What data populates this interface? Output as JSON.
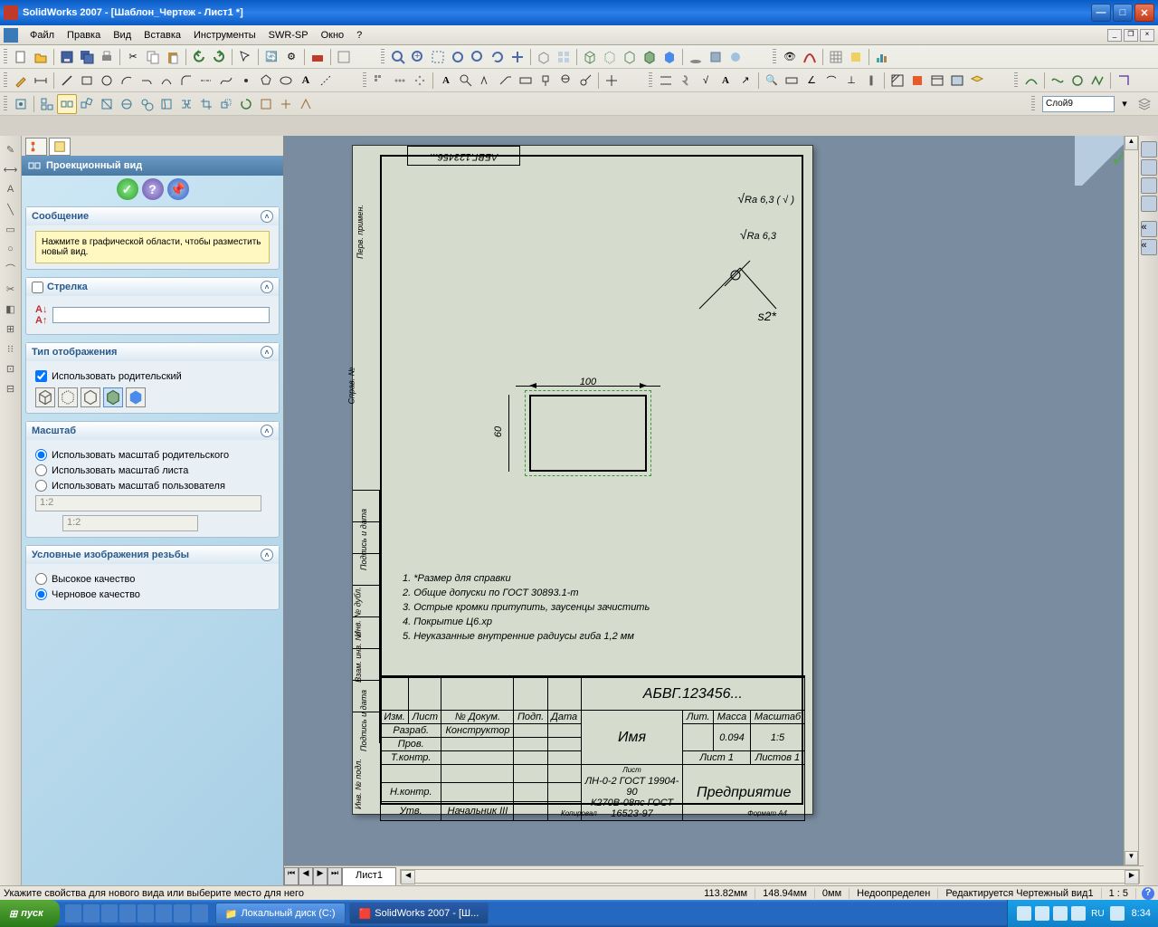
{
  "window": {
    "title": "SolidWorks 2007 - [Шаблон_Чертеж - Лист1 *]"
  },
  "menus": [
    "Файл",
    "Правка",
    "Вид",
    "Вставка",
    "Инструменты",
    "SWR-SP",
    "Окно",
    "?"
  ],
  "layer": "Слой9",
  "prop_panel": {
    "title": "Проекционный вид",
    "groups": {
      "message": {
        "title": "Сообщение",
        "text": "Нажмите в графической области, чтобы разместить новый вид."
      },
      "arrow": {
        "title": "Стрелка",
        "label": ""
      },
      "display": {
        "title": "Тип отображения",
        "use_parent": "Использовать родительский"
      },
      "scale": {
        "title": "Масштаб",
        "opts": [
          "Использовать масштаб родительского",
          "Использовать масштаб листа",
          "Использовать масштаб пользователя"
        ],
        "combo": "1:2",
        "input": "1:2"
      },
      "thread": {
        "title": "Условные изображения резьбы",
        "opts": [
          "Высокое качество",
          "Черновое качество"
        ]
      }
    }
  },
  "sheet_tab": "Лист1",
  "drawing": {
    "top_code": "АБВГ.123456...",
    "ra1": "Ra 6,3 ( √ )",
    "ra2": "Ra 6,3",
    "s2": "s2*",
    "dim_w": "100",
    "dim_h": "60",
    "notes": [
      "1.    *Размер для справки",
      "2.    Общие допуски по ГОСТ 30893.1-m",
      "3.    Острые кромки притупить, заусенцы зачистить",
      "4.    Покрытие Ц6.хр",
      "5.    Неуказанные внутренние радиусы гиба 1,2 мм"
    ],
    "titleblock": {
      "code": "АБВГ.123456...",
      "name": "Имя",
      "mass": "0.094",
      "scale": "1:5",
      "lit": "Лит.",
      "mass_h": "Масса",
      "scale_h": "Масштаб",
      "razrab": "Разраб.",
      "konstr": "Конструктор",
      "prov": "Пров.",
      "tkontr": "Т.контр.",
      "nkontr": "Н.контр.",
      "utv": "Утв.",
      "nach": "Начальник III",
      "list1": "Лист 1",
      "listov1": "Листов 1",
      "company": "Предприятие",
      "material1": "ЛН-0-2 ГОСТ 19904-90",
      "material2": "К270В-08пс ГОСТ 16523-97",
      "list_lbl": "Лист",
      "format": "Формат А4",
      "kopiroval": "Копировал",
      "izm": "Изм.",
      "list_h": "Лист",
      "ndokum": "№ Докум.",
      "podp": "Подп.",
      "data": "Дата"
    }
  },
  "status": {
    "hint": "Укажите свойства для нового вида или выберите место для него",
    "x": "113.82мм",
    "y": "148.94мм",
    "z": "0мм",
    "mode": "Недоопределен",
    "edit": "Редактируется Чертежный вид1",
    "vscale": "1 : 5"
  },
  "taskbar": {
    "start": "пуск",
    "tasks": [
      "Локальный диск (C:)",
      "SolidWorks 2007 - [Ш..."
    ],
    "lang": "RU",
    "time": "8:34"
  }
}
